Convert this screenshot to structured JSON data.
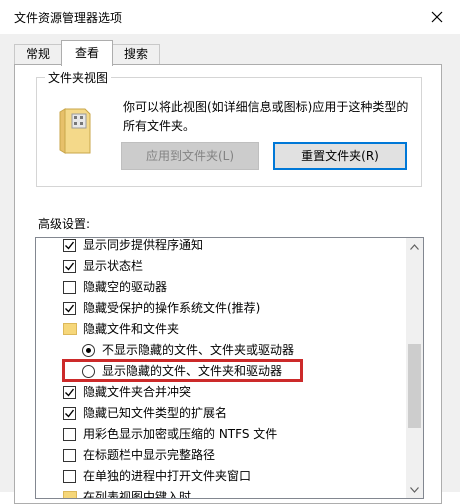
{
  "window": {
    "title": "文件资源管理器选项"
  },
  "tabs": [
    {
      "label": "常规"
    },
    {
      "label": "查看"
    },
    {
      "label": "搜索"
    }
  ],
  "folder_views": {
    "legend": "文件夹视图",
    "description": "你可以将此视图(如详细信息或图标)应用于这种类型的所有文件夹。",
    "apply_button": "应用到文件夹(L)",
    "reset_button": "重置文件夹(R)"
  },
  "advanced": {
    "label": "高级设置:",
    "items": [
      {
        "label": "显示同步提供程序通知",
        "type": "checkbox",
        "checked": true
      },
      {
        "label": "显示状态栏",
        "type": "checkbox",
        "checked": true
      },
      {
        "label": "隐藏空的驱动器",
        "type": "checkbox",
        "checked": false
      },
      {
        "label": "隐藏受保护的操作系统文件(推荐)",
        "type": "checkbox",
        "checked": true
      },
      {
        "label": "隐藏文件和文件夹",
        "type": "folder"
      },
      {
        "label": "不显示隐藏的文件、文件夹或驱动器",
        "type": "radio",
        "checked": true
      },
      {
        "label": "显示隐藏的文件、文件夹和驱动器",
        "type": "radio",
        "checked": false
      },
      {
        "label": "隐藏文件夹合并冲突",
        "type": "checkbox",
        "checked": true
      },
      {
        "label": "隐藏已知文件类型的扩展名",
        "type": "checkbox",
        "checked": true
      },
      {
        "label": "用彩色显示加密或压缩的 NTFS 文件",
        "type": "checkbox",
        "checked": false
      },
      {
        "label": "在标题栏中显示完整路径",
        "type": "checkbox",
        "checked": false
      },
      {
        "label": "在单独的进程中打开文件夹窗口",
        "type": "checkbox",
        "checked": false
      },
      {
        "label": "在列表视图中键入时",
        "type": "folder"
      }
    ]
  },
  "colors": {
    "accent": "#0078d7",
    "highlight_box": "#cc2a2a",
    "folder": "#f6d77a"
  }
}
